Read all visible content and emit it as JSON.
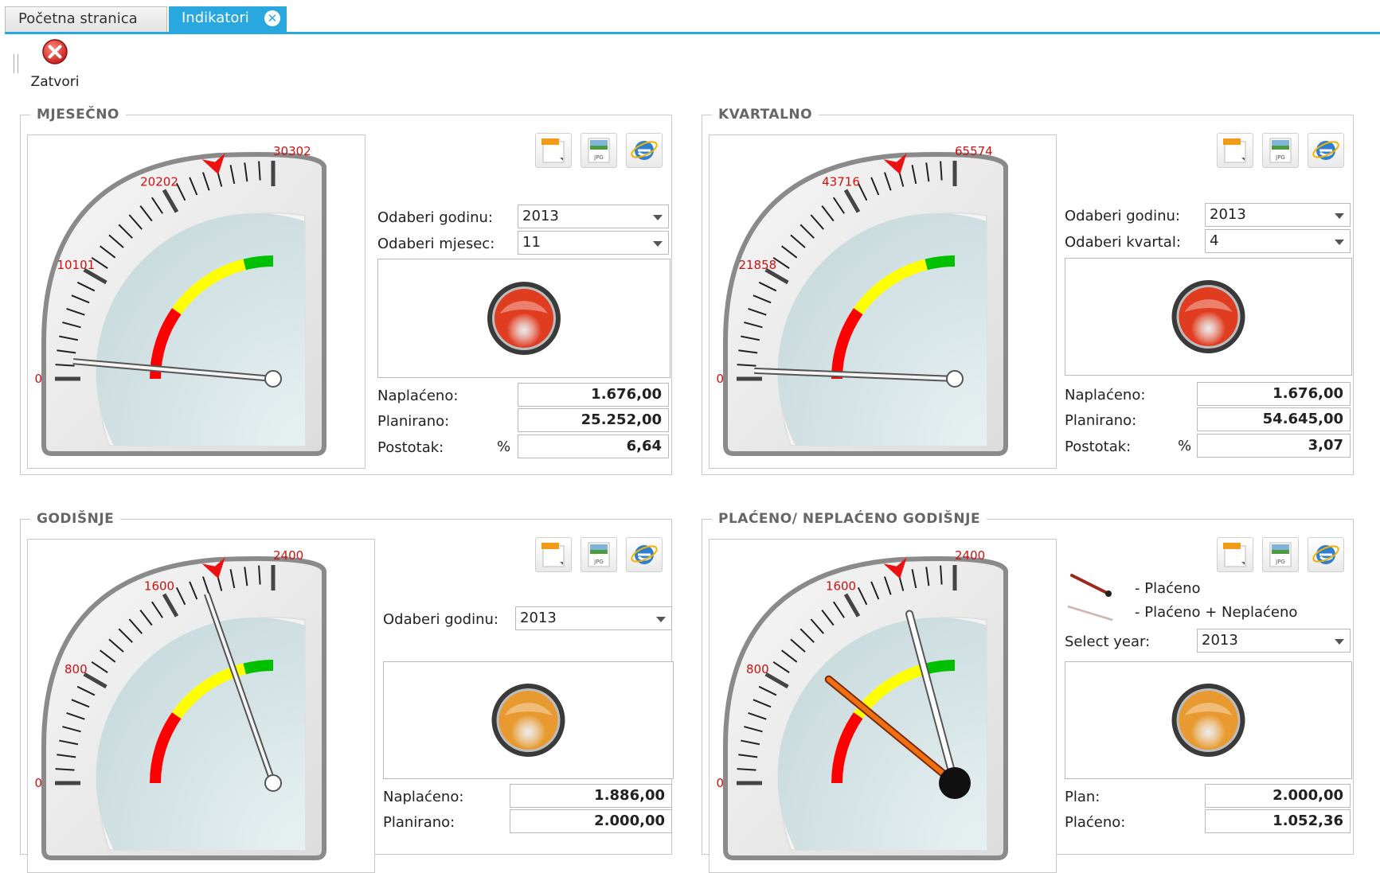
{
  "tabs": [
    {
      "label": "Početna stranica"
    },
    {
      "label": "Indikatori"
    }
  ],
  "toolbar": {
    "close_label": "Zatvori"
  },
  "colors": {
    "accent": "#29a8e0",
    "red": "#ff0000",
    "yellow": "#ffff00",
    "green": "#00c000",
    "lamp_red": "#e03c20",
    "lamp_orange": "#e89a30"
  },
  "panels": {
    "monthly": {
      "title": "MJESEČNO",
      "gauge": {
        "labels": [
          "0",
          "10101",
          "20202",
          "30302"
        ],
        "max": 30302,
        "value": 1676,
        "target": 25252
      },
      "year_label": "Odaberi godinu:",
      "year_value": "2013",
      "period_label": "Odaberi mjesec:",
      "period_value": "11",
      "lamp": "red",
      "rows": [
        {
          "label": "Naplaćeno:",
          "value": "1.676,00"
        },
        {
          "label": "Planirano:",
          "value": "25.252,00"
        },
        {
          "label": "Postotak:",
          "unit": "%",
          "value": "6,64"
        }
      ]
    },
    "quarterly": {
      "title": "KVARTALNO",
      "gauge": {
        "labels": [
          "0",
          "21858",
          "43716",
          "65574"
        ],
        "max": 65574,
        "value": 1676,
        "target": 54645
      },
      "year_label": "Odaberi godinu:",
      "year_value": "2013",
      "period_label": "Odaberi kvartal:",
      "period_value": "4",
      "lamp": "red",
      "rows": [
        {
          "label": "Naplaćeno:",
          "value": "1.676,00"
        },
        {
          "label": "Planirano:",
          "value": "54.645,00"
        },
        {
          "label": "Postotak:",
          "unit": "%",
          "value": "3,07"
        }
      ]
    },
    "yearly": {
      "title": "GODIŠNJE",
      "gauge": {
        "labels": [
          "0",
          "800",
          "1600",
          "2400"
        ],
        "max": 2400,
        "value": 1886,
        "target": 2000
      },
      "year_label": "Odaberi godinu:",
      "year_value": "2013",
      "lamp": "orange",
      "rows": [
        {
          "label": "Naplaćeno:",
          "value": "1.886,00"
        },
        {
          "label": "Planirano:",
          "value": "2.000,00"
        }
      ]
    },
    "paid": {
      "title": "PLAĆENO/ NEPLAĆENO GODIŠNJE",
      "gauge": {
        "labels": [
          "0",
          "800",
          "1600",
          "2400"
        ],
        "max": 2400,
        "paid": 1052.36,
        "paid_unpaid": 2000,
        "target": 2000
      },
      "legend_paid": "- Plaćeno",
      "legend_paid_unpaid": "- Plaćeno + Neplaćeno",
      "year_label": "Select year:",
      "year_value": "2013",
      "lamp": "orange",
      "rows": [
        {
          "label": "Plan:",
          "value": "2.000,00"
        },
        {
          "label": "Plaćeno:",
          "value": "1.052,36"
        }
      ]
    }
  }
}
